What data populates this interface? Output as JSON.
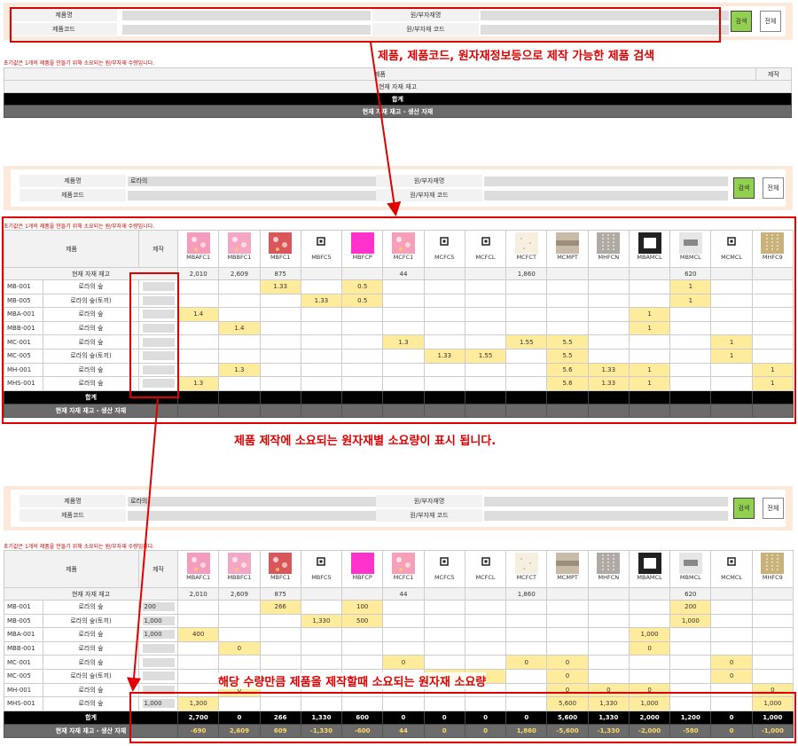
{
  "search": {
    "product_name_label": "제품명",
    "product_code_label": "제품코드",
    "material_name_label": "원/부자재명",
    "material_code_label": "원/부자재 코드",
    "search_button": "검색",
    "all_button": "전체"
  },
  "note": "초기값은 1개의 제품을 만들기 위해 소요되는 원/부자재 수량입니다.",
  "annotations": {
    "a1": "제품, 제품코드, 원자재정보등으로 제작 가능한 제품 검색",
    "a2": "제품 제작에 소요되는 원자재별 소요량이 표시 됩니다.",
    "a3": "해당 수량만큼 제품을 제작할때 소요되는 원자재 소요량"
  },
  "panel1": {
    "col_product": "제품",
    "col_make": "제작",
    "current_stock": "현재 자재 재고",
    "total": "합계",
    "stock_minus": "현재 자재 재고 - 생산 자재"
  },
  "panel2": {
    "product_name_value": "로라의"
  },
  "panel3": {
    "product_name_value": "로라의"
  },
  "grid_headers": {
    "product": "제품",
    "make": "제작",
    "current_stock": "현재 자재 재고",
    "total": "합계",
    "stock_minus": "현재 자재 재고 - 생산 자재"
  },
  "materials": [
    {
      "code": "MBAFC1",
      "stock": "2,010",
      "thumb": "pink-print",
      "color": "#f59bbd"
    },
    {
      "code": "MBBFC1",
      "stock": "2,609",
      "thumb": "pink-print",
      "color": "#f4a7c4"
    },
    {
      "code": "MBFC1",
      "stock": "875",
      "thumb": "red-print",
      "color": "#d9565a"
    },
    {
      "code": "MBFC5",
      "stock": "",
      "thumb": "small-icon",
      "color": "#ffffff"
    },
    {
      "code": "MBFCP",
      "stock": "",
      "thumb": "magenta",
      "color": "#ff33cc"
    },
    {
      "code": "MCFC1",
      "stock": "44",
      "thumb": "pink-print",
      "color": "#f5a0b8"
    },
    {
      "code": "MCFC5",
      "stock": "",
      "thumb": "small-icon",
      "color": "#ffffff"
    },
    {
      "code": "MCFCL",
      "stock": "",
      "thumb": "small-icon",
      "color": "#ffffff"
    },
    {
      "code": "MCFCT",
      "stock": "1,860",
      "thumb": "cream-dots",
      "color": "#f6efdf"
    },
    {
      "code": "MCMPT",
      "stock": "",
      "thumb": "beige-strip",
      "color": "#c8bca8"
    },
    {
      "code": "MHFCN",
      "stock": "",
      "thumb": "gray-chain",
      "color": "#b0aaa4"
    },
    {
      "code": "MBAMCL",
      "stock": "",
      "thumb": "black-label",
      "color": "#222222"
    },
    {
      "code": "MBMCL",
      "stock": "620",
      "thumb": "white-label",
      "color": "#e6e6e6"
    },
    {
      "code": "MCMCL",
      "stock": "",
      "thumb": "small-icon",
      "color": "#ffffff"
    },
    {
      "code": "MHFC9",
      "stock": "",
      "thumb": "gold-chain",
      "color": "#c9b27a"
    }
  ],
  "rows2": [
    {
      "code": "MB-001",
      "name": "로라의 숲",
      "cells": {
        "2": "1.33",
        "4": "0.5",
        "12": "1"
      }
    },
    {
      "code": "MB-005",
      "name": "로라의 숲(토끼)",
      "cells": {
        "3": "1.33",
        "4": "0.5",
        "12": "1"
      }
    },
    {
      "code": "MBA-001",
      "name": "로라의 숲",
      "cells": {
        "0": "1.4",
        "11": "1"
      }
    },
    {
      "code": "MBB-001",
      "name": "로라의 숲",
      "cells": {
        "1": "1.4",
        "11": "1"
      }
    },
    {
      "code": "MC-001",
      "name": "로라의 숲",
      "cells": {
        "5": "1.3",
        "8": "1.55",
        "9": "5.5",
        "13": "1"
      }
    },
    {
      "code": "MC-005",
      "name": "로라의 숲(토끼)",
      "cells": {
        "6": "1.33",
        "7": "1.55",
        "9": "5.5",
        "13": "1"
      }
    },
    {
      "code": "MH-001",
      "name": "로라의 숲",
      "cells": {
        "1": "1.3",
        "9": "5.6",
        "10": "1.33",
        "11": "1",
        "14": "1"
      }
    },
    {
      "code": "MHS-001",
      "name": "로라의 숲",
      "cells": {
        "0": "1.3",
        "9": "5.6",
        "10": "1.33",
        "11": "1",
        "14": "1"
      }
    }
  ],
  "rows3": [
    {
      "code": "MB-001",
      "name": "로라의 숲",
      "qty": "200",
      "cells": {
        "2": "266",
        "4": "100",
        "12": "200"
      }
    },
    {
      "code": "MB-005",
      "name": "로라의 숲(토끼)",
      "qty": "1,000",
      "cells": {
        "3": "1,330",
        "4": "500",
        "12": "1,000"
      }
    },
    {
      "code": "MBA-001",
      "name": "로라의 숲",
      "qty": "1,000",
      "cells": {
        "0": "400",
        "11": "1,000"
      }
    },
    {
      "code": "MBB-001",
      "name": "로라의 숲",
      "qty": "",
      "cells": {
        "1": "0",
        "11": "0"
      }
    },
    {
      "code": "MC-001",
      "name": "로라의 숲",
      "qty": "",
      "cells": {
        "5": "0",
        "8": "0",
        "9": "0",
        "13": "0"
      }
    },
    {
      "code": "MC-005",
      "name": "로라의 숲(토끼)",
      "qty": "",
      "cells": {
        "6": "",
        "7": "",
        "9": "0",
        "13": "0"
      }
    },
    {
      "code": "MH-001",
      "name": "로라의 숲",
      "qty": "",
      "cells": {
        "1": "0",
        "9": "0",
        "10": "0",
        "11": "0",
        "14": "0"
      }
    },
    {
      "code": "MHS-001",
      "name": "로라의 숲",
      "qty": "1,000",
      "cells": {
        "0": "1,300",
        "9": "5,600",
        "10": "1,330",
        "11": "1,000",
        "14": "1,000"
      }
    }
  ],
  "totals3": [
    "2,700",
    "0",
    "266",
    "1,330",
    "600",
    "0",
    "0",
    "0",
    "0",
    "5,600",
    "1,330",
    "2,000",
    "1,200",
    "0",
    "1,000"
  ],
  "remain3": [
    "-690",
    "2,609",
    "609",
    "-1,330",
    "-600",
    "44",
    "0",
    "0",
    "1,860",
    "-5,600",
    "-1,330",
    "-2,000",
    "-580",
    "0",
    "-1,000"
  ]
}
